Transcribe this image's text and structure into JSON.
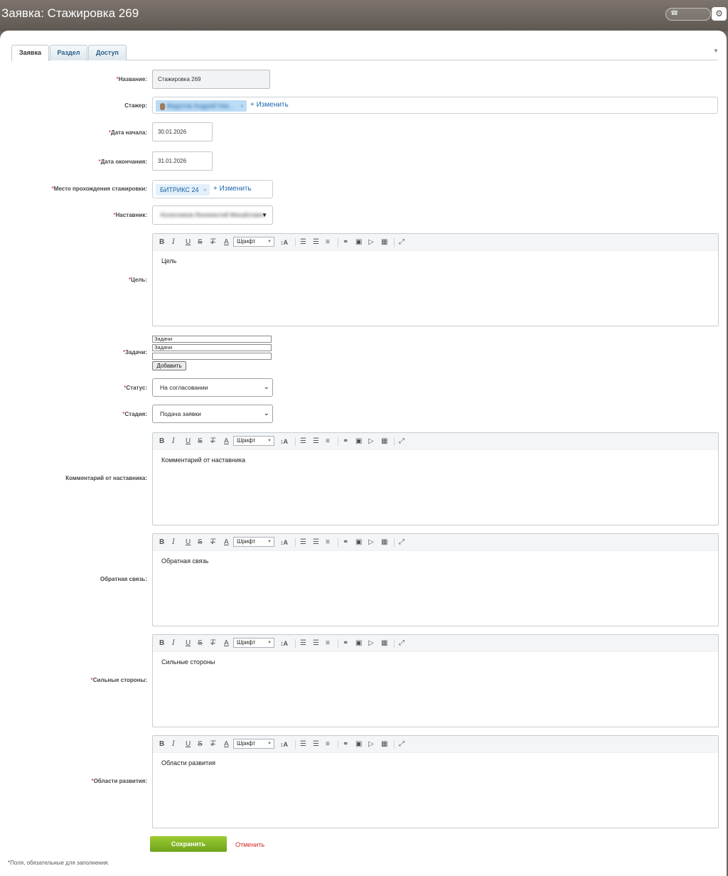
{
  "header": {
    "title": "Заявка: Стажировка 269",
    "settings_icon": "gear-icon"
  },
  "tabs": [
    {
      "label": "Заявка",
      "active": true
    },
    {
      "label": "Раздел",
      "active": false
    },
    {
      "label": "Доступ",
      "active": false
    }
  ],
  "form": {
    "required_mark": "*",
    "name": {
      "label": "Название:",
      "value": "Стажировка 269"
    },
    "intern": {
      "label": "Стажер:",
      "chip": "Федотов Андрей Ник...",
      "change": "+ Изменить"
    },
    "start_date": {
      "label": "Дата начала:",
      "value": "30.01.2026"
    },
    "end_date": {
      "label": "Дата окончания:",
      "value": "31.01.2026"
    },
    "place": {
      "label": "Место прохождения стажировки:",
      "chip": "БИТРИКС 24",
      "change": "+ Изменить"
    },
    "mentor": {
      "label": "Наставник:",
      "value": "Колесников Иннокентий Михайлович"
    },
    "goal": {
      "label": "Цель:",
      "placeholder": "Цель"
    },
    "tasks": {
      "label": "Задачи:",
      "rows": [
        "Задачи",
        "Задачи",
        ""
      ],
      "add_button": "Добавить"
    },
    "status": {
      "label": "Статус:",
      "value": "На согласовании"
    },
    "stage": {
      "label": "Стадия:",
      "value": "Подача заявки"
    },
    "mentor_comment": {
      "label": "Комментарий от наставника:",
      "placeholder": "Комментарий от наставника"
    },
    "feedback": {
      "label": "Обратная связь:",
      "placeholder": "Обратная связь"
    },
    "strengths": {
      "label": "Сильные стороны:",
      "placeholder": "Сильные стороны"
    },
    "growth_areas": {
      "label": "Области развития:",
      "placeholder": "Области развития"
    }
  },
  "editor_toolbar": {
    "bold": "B",
    "italic": "I",
    "underline": "U",
    "strike": "S",
    "clear_format": "T",
    "font_color": "A",
    "font_select": "Шрифт",
    "font_size": "↕A"
  },
  "actions": {
    "save": "Сохранить",
    "cancel": "Отменить"
  },
  "footnote": "*Поля, обязательные для заполнения.",
  "colors": {
    "save_green": "#7fb524",
    "cancel_red": "#d12b2b",
    "link_blue": "#2067b0",
    "chip_blue": "#bcdcf6"
  }
}
